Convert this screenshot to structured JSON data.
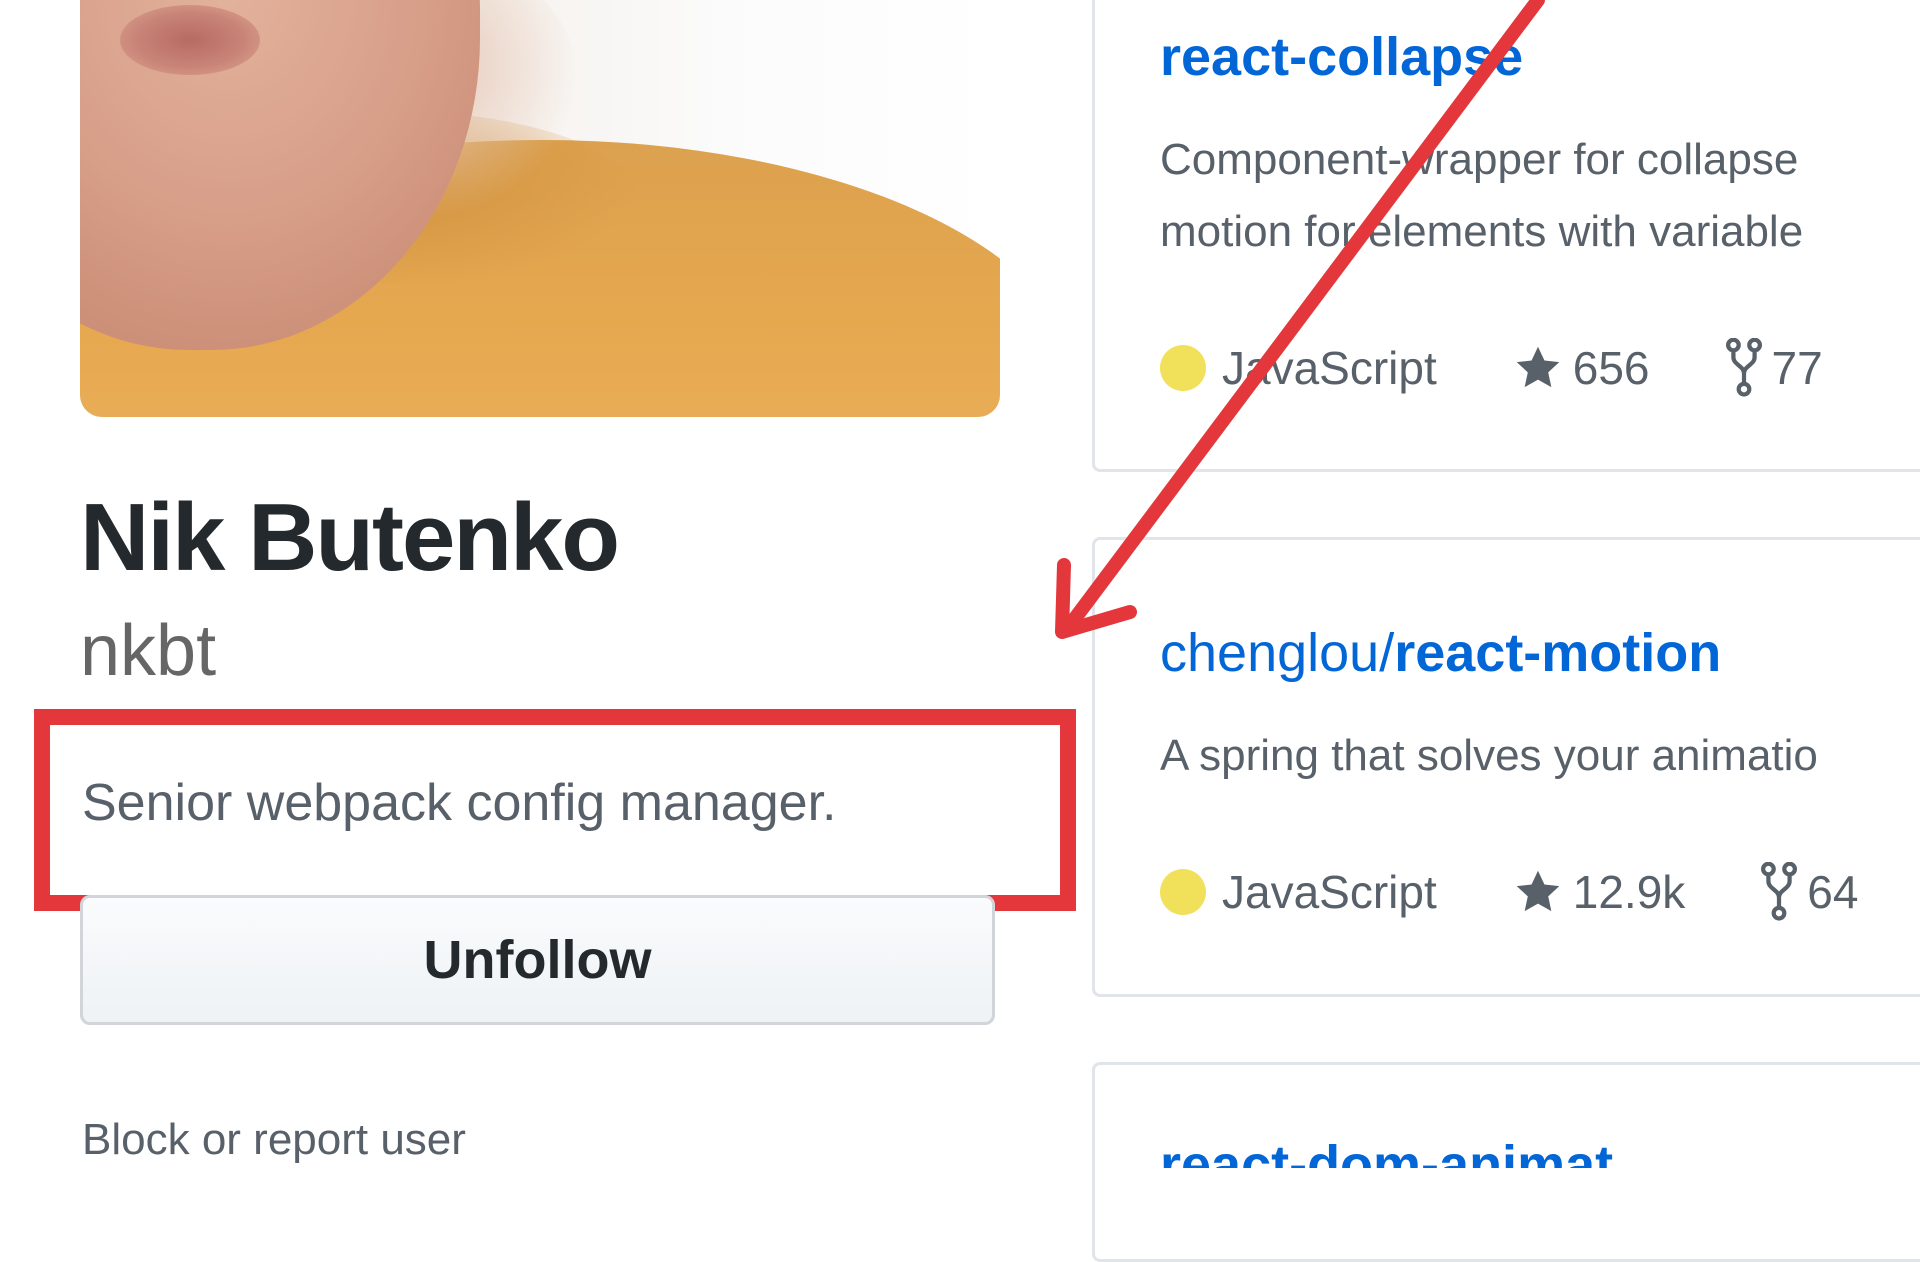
{
  "profile": {
    "name": "Nik Butenko",
    "username": "nkbt",
    "bio": "Senior webpack config manager.",
    "unfollow_label": "Unfollow",
    "block_report_label": "Block or report user"
  },
  "repos": [
    {
      "name": "react-collapse",
      "description_lines": [
        "Component-wrapper for collapse",
        "motion for elements with variable"
      ],
      "language": "JavaScript",
      "language_color": "#f1e05a",
      "stars": "656",
      "forks": "77"
    },
    {
      "owner": "chenglou/",
      "name": "react-motion",
      "description_lines": [
        "A spring that solves your animatio"
      ],
      "language": "JavaScript",
      "language_color": "#f1e05a",
      "stars": "12.9k",
      "forks": "64"
    }
  ],
  "partial_repo_title": "react-dom-animat",
  "annotation": {
    "color": "#e3373c"
  }
}
